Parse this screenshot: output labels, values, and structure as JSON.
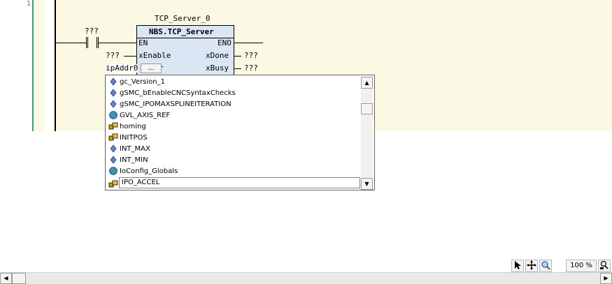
{
  "editor": {
    "line_number": "1",
    "instance_name": "TCP_Server_0",
    "fb_type": "NBS.TCP_Server",
    "pins_in": [
      "EN",
      "xEnable",
      "ipAddr"
    ],
    "pins_out": [
      "ENO",
      "xDone",
      "xBusy"
    ],
    "contact_var": "???",
    "in_xEnable_var": "???",
    "in_ipAddr_var": "ipAddr0",
    "input_assist_label": "...",
    "out_xDone_var": "???",
    "out_xBusy_var": "???"
  },
  "autocomplete": {
    "items": [
      {
        "label": "gc_Version_1",
        "icon": "constant-icon"
      },
      {
        "label": "gSMC_bEnableCNCSyntaxChecks",
        "icon": "constant-icon"
      },
      {
        "label": "gSMC_IPOMAXSPLINEITERATION",
        "icon": "constant-icon"
      },
      {
        "label": "GVL_AXIS_REF",
        "icon": "globe-icon"
      },
      {
        "label": "homing",
        "icon": "program-icon"
      },
      {
        "label": "INITPOS",
        "icon": "program-icon"
      },
      {
        "label": "INT_MAX",
        "icon": "constant-icon"
      },
      {
        "label": "INT_MIN",
        "icon": "constant-icon"
      },
      {
        "label": "IoConfig_Globals",
        "icon": "globe-icon"
      }
    ],
    "edit_value": "IPO_ACCEL",
    "edit_icon": "program-icon"
  },
  "statusbar": {
    "zoom": "100 %"
  },
  "colors": {
    "network_bg": "#fbf8e3",
    "fb_fill": "#dbe6f5",
    "gutter_line": "#2f9d8e"
  }
}
